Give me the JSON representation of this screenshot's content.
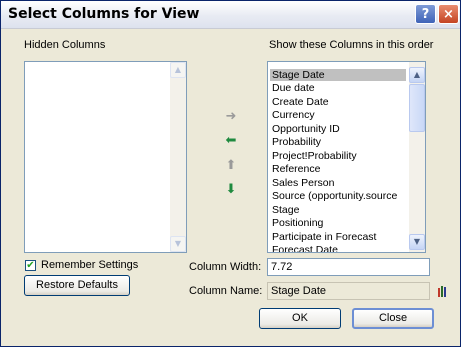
{
  "window": {
    "title": "Select Columns for View",
    "help_label": "?",
    "close_label": "×"
  },
  "hidden_columns": {
    "label": "Hidden Columns",
    "items": []
  },
  "shown_columns": {
    "label": "Show these Columns in this order",
    "items": [
      "Stage Date",
      "Due date",
      "Create Date",
      "Currency",
      "Opportunity ID",
      "Probability",
      "Project!Probability",
      "Reference",
      "Sales Person",
      "Source (opportunity.source",
      "Stage",
      "Positioning",
      "Participate in Forecast",
      "Forecast Date"
    ],
    "selected": "Stage Date"
  },
  "move_buttons": {
    "right": "➜",
    "left": "⬅",
    "up": "⬆",
    "down": "⬇"
  },
  "remember_settings": {
    "label": "Remember Settings",
    "checked": "✔"
  },
  "restore_defaults": {
    "label": "Restore Defaults"
  },
  "column_width": {
    "label": "Column Width:",
    "value": "7.72"
  },
  "column_name": {
    "label": "Column Name:",
    "value": "Stage Date"
  },
  "ok_button": {
    "label": "OK"
  },
  "close_button": {
    "label": "Close"
  },
  "colors": {
    "arrow_gray": "#9a9a9a",
    "arrow_green": "#1f8a3f",
    "selection": "#c0c0c0"
  }
}
